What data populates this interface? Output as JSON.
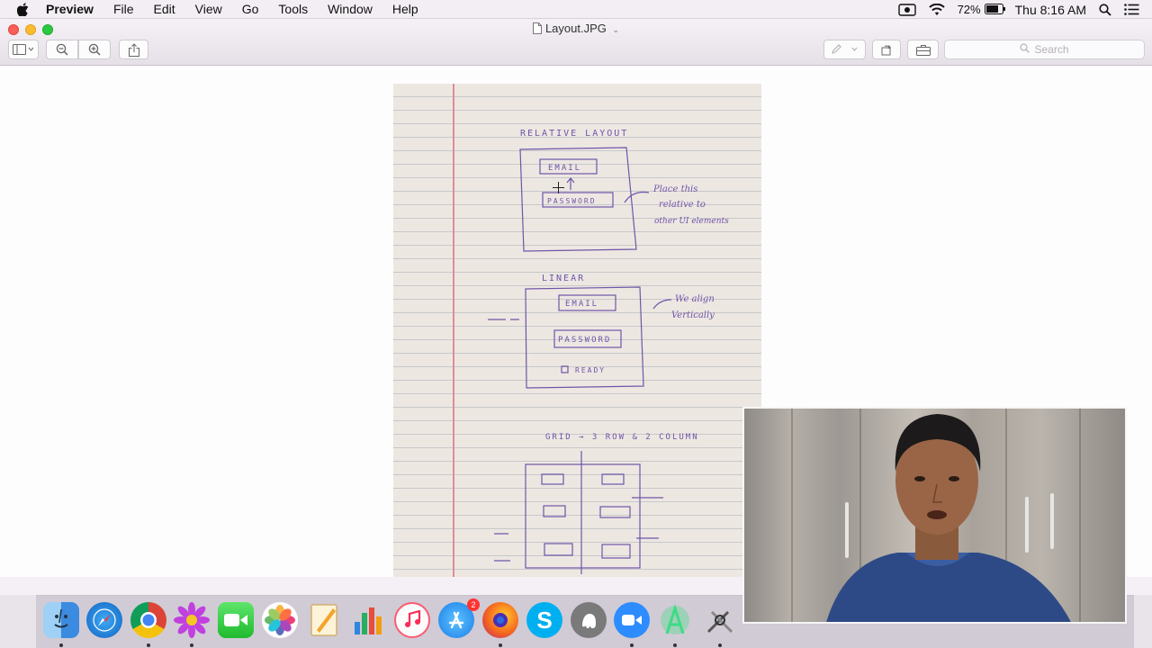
{
  "menubar": {
    "app_name": "Preview",
    "menus": [
      "File",
      "Edit",
      "View",
      "Go",
      "Tools",
      "Window",
      "Help"
    ],
    "battery": "72%",
    "clock": "Thu 8:16 AM"
  },
  "window": {
    "document_title": "Layout.JPG",
    "search_placeholder": "Search"
  },
  "notebook": {
    "relative": {
      "title": "RELATIVE LAYOUT",
      "field1": "EMAIL",
      "field2": "PASSWORD",
      "note": [
        "Place this",
        "relative to",
        "other UI elements"
      ]
    },
    "linear": {
      "title": "LINEAR",
      "field1": "EMAIL",
      "field2": "PASSWORD",
      "checkbox": "READY",
      "note": [
        "We align",
        "Vertically"
      ]
    },
    "grid": {
      "title": "GRID → 3 ROW & 2 COLUMN"
    }
  },
  "dock": {
    "apps": [
      "finder",
      "safari",
      "chrome",
      "daisy",
      "facetime",
      "photos",
      "pages",
      "numbers",
      "itunes",
      "app-store",
      "firefox",
      "skype",
      "evernote",
      "zoom",
      "android-studio",
      "utilities"
    ],
    "app_store_badge": "2"
  }
}
